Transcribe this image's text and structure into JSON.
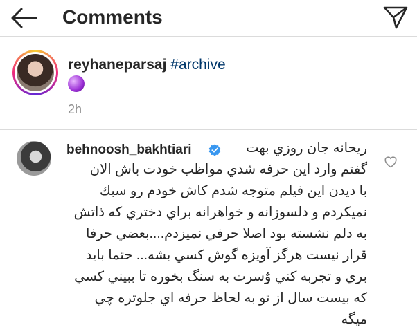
{
  "header": {
    "title": "Comments",
    "icons": {
      "back": "arrow-left-icon",
      "send": "paper-plane-icon"
    }
  },
  "caption": {
    "username": "reyhaneparsaj",
    "hashtag": "#archive",
    "emoji": "crystal-ball-icon",
    "time": "2h"
  },
  "comment": {
    "username": "behnoosh_bakhtiari",
    "verified": true,
    "lines": [
      "ريحانه جان روزي بهت",
      "گفتم وارد اين حرفه شدي مواظب خودت باش الان",
      "با ديدن اين فيلم متوجه شدم كاش خودم رو سبك",
      "نميكردم و دلسوزانه و خواهرانه براي دختري كه ذاتش",
      "به دلم نشسته بود اصلا حرفي نميزدم....بعضي حرفا",
      "قرار نيست هرگز آويزه گوش كسي بشه... حتما بايد",
      "بري و تجربه كني وٌسرت به سنگ بخوره تا ببيني كسي",
      "كه بيست سال از تو به لحاظ حرفه اي جلوتره چي",
      "ميگه"
    ],
    "like_icon": "heart-icon"
  },
  "colors": {
    "text": "#262626",
    "secondary": "#8e8e8e",
    "hashtag": "#00376b",
    "verified": "#3897f0",
    "divider": "#dbdbdb"
  }
}
